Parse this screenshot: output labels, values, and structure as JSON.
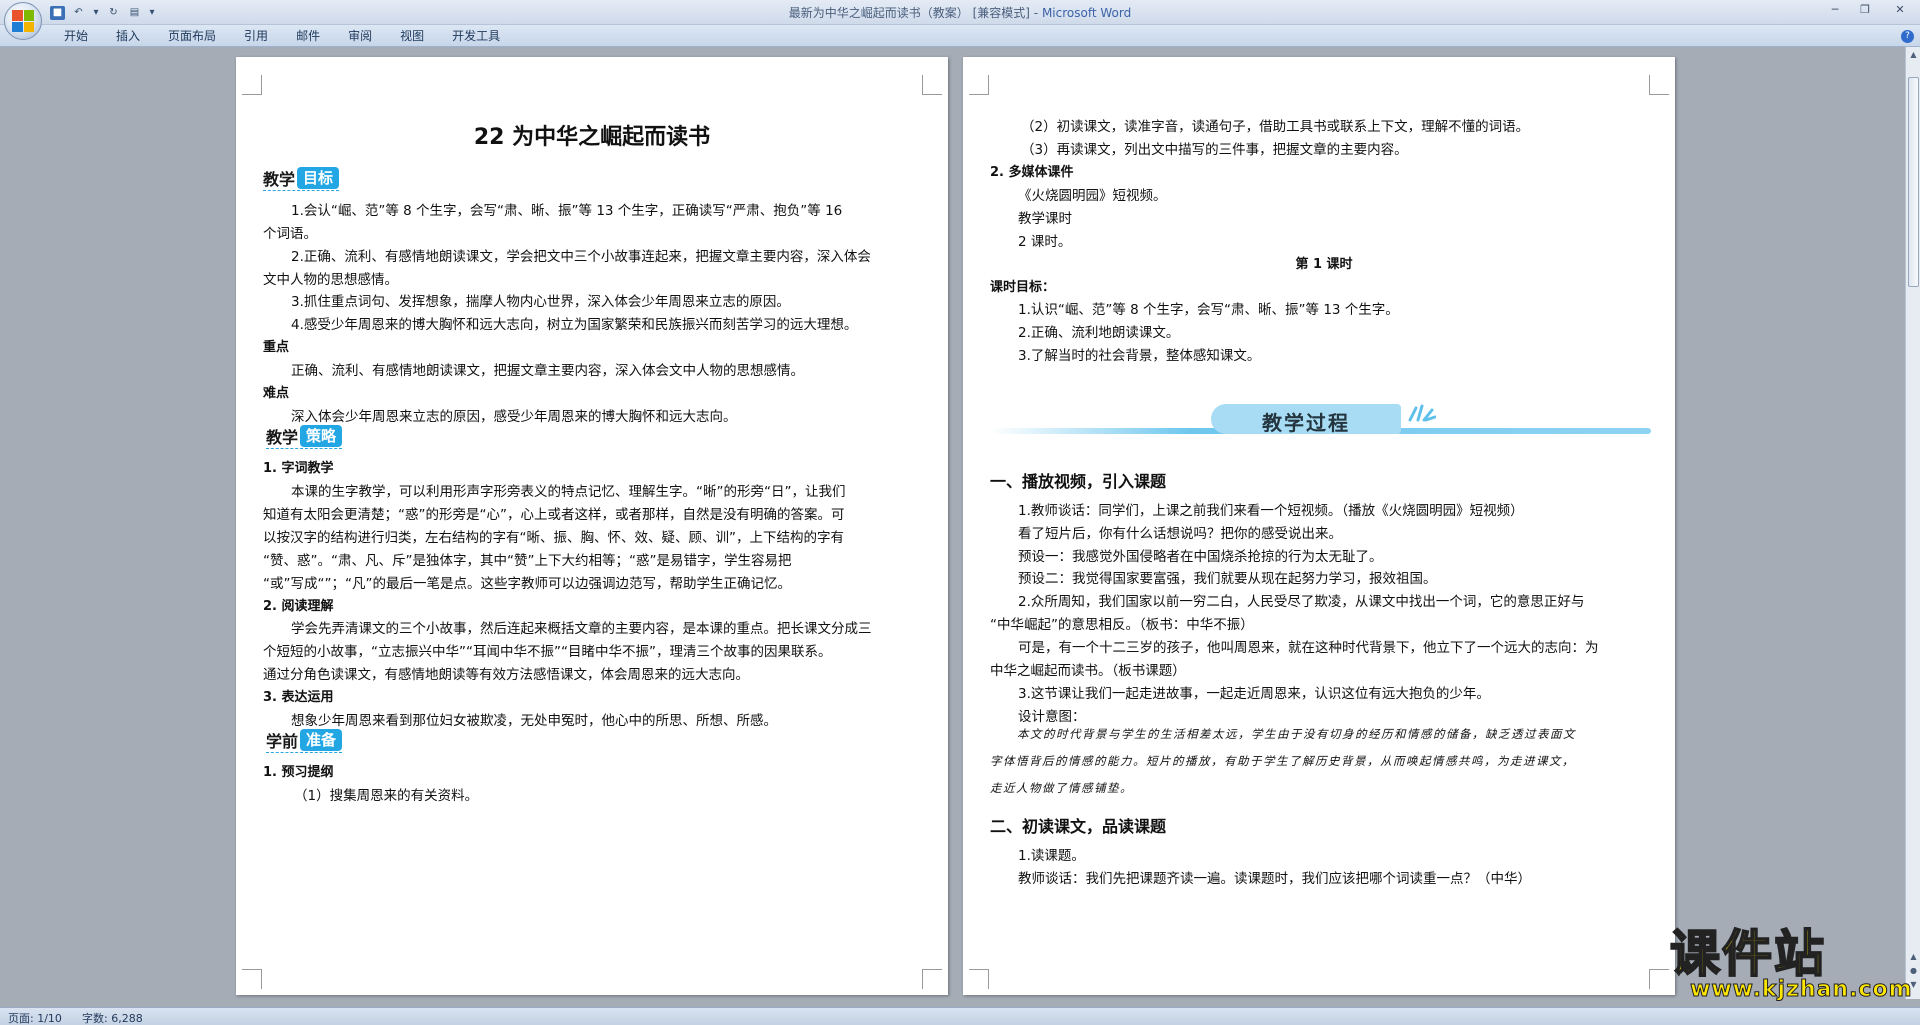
{
  "window": {
    "title_doc": "最新为中华之崛起而读书（教案）",
    "title_mode": "[兼容模式] -",
    "title_app": "Microsoft Word"
  },
  "ribbon": {
    "tabs": [
      "开始",
      "插入",
      "页面布局",
      "引用",
      "邮件",
      "审阅",
      "视图",
      "开发工具"
    ]
  },
  "status": {
    "page": "页面: 1/10",
    "words": "字数: 6,288"
  },
  "page1": {
    "title": "22 为中华之崛起而读书",
    "heading_goal": [
      "教学",
      "目标"
    ],
    "goals": [
      "1.会认“崛、范”等 8 个生字，会写“肃、晰、振”等 13 个生字，正确读写“严肃、抱负”等 16",
      "个词语。",
      "2.正确、流利、有感情地朗读课文，学会把文中三个小故事连起来，把握文章主要内容，深入体会",
      "文中人物的思想感情。",
      "3.抓住重点词句、发挥想象，揣摩人物内心世界，深入体会少年周恩来立志的原因。",
      "4.感受少年周恩来的博大胸怀和远大志向，树立为国家繁荣和民族振兴而刻苦学习的远大理想。"
    ],
    "key_label": "重点",
    "key_text": "正确、流利、有感情地朗读课文，把握文章主要内容，深入体会文中人物的思想感情。",
    "diff_label": "难点",
    "diff_text": "深入体会少年周恩来立志的原因，感受少年周恩来的博大胸怀和远大志向。",
    "heading_strategy": [
      "教学",
      "策略"
    ],
    "s1_label": "1. 字词教学",
    "s1_text": [
      "本课的生字教学，可以利用形声字形旁表义的特点记忆、理解生字。“晰”的形旁“日”，让我们",
      "知道有太阳会更清楚；“惑”的形旁是“心”，心上或者这样，或者那样，自然是没有明确的答案。可",
      "以按汉字的结构进行归类，左右结构的字有“晰、振、胸、怀、效、疑、顾、训”，上下结构的字有",
      "“赞、惑”。“肃、凡、斥”是独体字，其中“赞”上下大约相等；“惑”是易错字，学生容易把",
      "“或”写成“”；“凡”的最后一笔是点。这些字教师可以边强调边范写，帮助学生正确记忆。"
    ],
    "s2_label": "2. 阅读理解",
    "s2_text": [
      "学会先弄清课文的三个小故事，然后连起来概括文章的主要内容，是本课的重点。把长课文分成三",
      "个短短的小故事，“立志振兴中华”“耳闻中华不振”“目睹中华不振”，理清三个故事的因果联系。",
      "通过分角色读课文，有感情地朗读等有效方法感悟课文，体会周恩来的远大志向。"
    ],
    "s3_label": "3. 表达运用",
    "s3_text": "想象少年周恩来看到那位妇女被欺凌，无处申冤时，他心中的所思、所想、所感。",
    "heading_prep": [
      "学前",
      "准备"
    ],
    "p1_label": "1. 预习提纲",
    "p1_text": "（1）搜集周恩来的有关资料。"
  },
  "page2": {
    "top_lines": [
      "（2）初读课文，读准字音，读通句子，借助工具书或联系上下文，理解不懂的词语。",
      "（3）再读课文，列出文中描写的三件事，把握文章的主要内容。"
    ],
    "media_label": "2. 多媒体课件",
    "media_text": "《火烧圆明园》短视频。",
    "period_label": "教学课时",
    "period_value": "2 课时。",
    "lesson_title": "第 1 课时",
    "lesson_goal_label": "课时目标：",
    "lesson_goals": [
      "1.认识“崛、范”等 8 个生字，会写“肃、晰、振”等 13 个生字。",
      "2.正确、流利地朗读课文。",
      "3.了解当时的社会背景，整体感知课文。"
    ],
    "process_banner": "教学过程",
    "sec1": "一、播放视频，引入课题",
    "sec1_lines": [
      "1.教师谈话：同学们，上课之前我们来看一个短视频。（播放《火烧圆明园》短视频）",
      "看了短片后，你有什么话想说吗？把你的感受说出来。",
      "预设一：我感觉外国侵略者在中国烧杀抢掠的行为太无耻了。",
      "预设二：我觉得国家要富强，我们就要从现在起努力学习，报效祖国。",
      "2.众所周知，我们国家以前一穷二白，人民受尽了欺凌，从课文中找出一个词，它的意思正好与",
      "“中华崛起”的意思相反。（板书：中华不振）",
      "可是，有一个十二三岁的孩子，他叫周恩来，就在这种时代背景下，他立下了一个远大的志向：为",
      "中华之崛起而读书。（板书课题）",
      "3.这节课让我们一起走进故事，一起走近周恩来，认识这位有远大抱负的少年。",
      "设计意图："
    ],
    "note_lines": [
      "本文的时代背景与学生的生活相差太远，学生由于没有切身的经历和情感的储备，缺乏透过表面文",
      "字体悟背后的情感的能力。短片的播放，有助于学生了解历史背景，从而唤起情感共鸣，为走进课文，",
      "走近人物做了情感铺垫。"
    ],
    "sec2": "二、初读课文，品读课题",
    "sec2_lines": [
      "1.读课题。",
      "教师谈话：我们先把课题齐读一遍。读课题时，我们应该把哪个词读重一点？（中华）"
    ]
  },
  "watermark": {
    "name": "课件站",
    "url": "www.kjzhan.com"
  }
}
